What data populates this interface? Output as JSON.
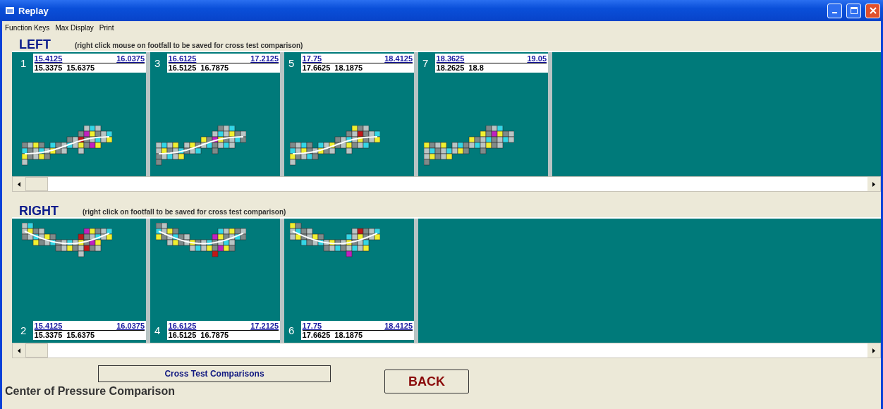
{
  "window": {
    "title": "Replay"
  },
  "menu": [
    "Function Keys",
    "Max Display",
    "Print"
  ],
  "sections": [
    {
      "side": "LEFT",
      "hint": "(right click mouse on footfall to be saved for cross test comparison)",
      "kind": "top",
      "footfalls": [
        {
          "number": "1",
          "values": [
            "15.4125",
            "16.0375",
            "15.3375",
            "15.6375"
          ]
        },
        {
          "number": "3",
          "values": [
            "16.6125",
            "17.2125",
            "16.5125",
            "16.7875"
          ]
        },
        {
          "number": "5",
          "values": [
            "17.75",
            "18.4125",
            "17.6625",
            "18.1875"
          ]
        },
        {
          "number": "7",
          "values": [
            "18.3625",
            "19.05",
            "18.2625",
            "18.8"
          ]
        }
      ]
    },
    {
      "side": "RIGHT",
      "hint": "(right click on footfall to be saved for cross test comparison)",
      "kind": "bottom",
      "footfalls": [
        {
          "number": "2",
          "values": [
            "15.4125",
            "16.0375",
            "15.3375",
            "15.6375"
          ]
        },
        {
          "number": "4",
          "values": [
            "16.6125",
            "17.2125",
            "16.5125",
            "16.7875"
          ]
        },
        {
          "number": "6",
          "values": [
            "17.75",
            "18.4125",
            "17.6625",
            "18.1875"
          ]
        }
      ]
    }
  ],
  "cross_test_button": "Cross Test Comparisons",
  "caption": "Center of Pressure Comparison",
  "back_button": "BACK"
}
